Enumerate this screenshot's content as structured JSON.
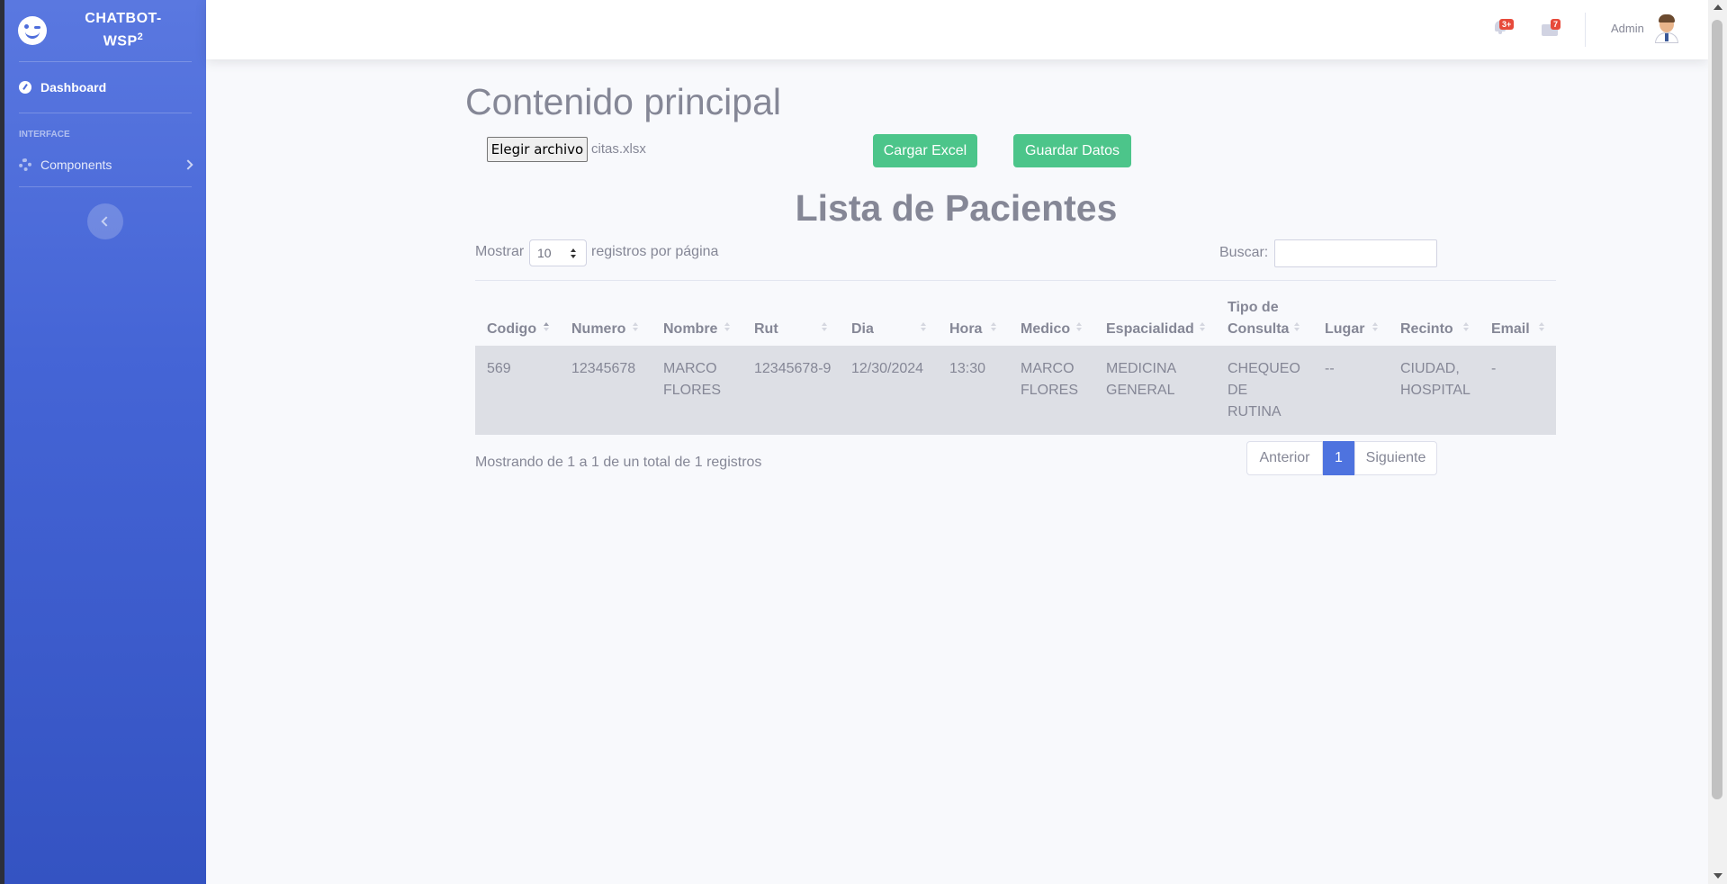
{
  "sidebar": {
    "brand_line1": "CHATBOT-",
    "brand_line2": "WSP",
    "brand_sup": "2",
    "nav_dashboard": "Dashboard",
    "heading_interface": "INTERFACE",
    "nav_components": "Components"
  },
  "topbar": {
    "alerts_badge": "3+",
    "messages_badge": "7",
    "user_name": "Admin"
  },
  "main": {
    "page_title": "Contenido principal",
    "file_button_label": "Elegir archivo",
    "file_name": "citas.xlsx",
    "load_button_label": "Cargar Excel",
    "save_button_label": "Guardar Datos",
    "list_title": "Lista de Pacientes",
    "show_label": "Mostrar",
    "page_size_value": "10",
    "show_suffix": "registros por página",
    "search_label": "Buscar:",
    "search_value": ""
  },
  "table": {
    "columns": [
      "Codigo",
      "Numero",
      "Nombre",
      "Rut",
      "Dia",
      "Hora",
      "Medico",
      "Espacialidad",
      "Tipo de Consulta",
      "Lugar",
      "Recinto",
      "Email"
    ],
    "rows": [
      {
        "codigo": "569",
        "numero": "12345678",
        "nombre": "MARCO FLORES",
        "rut": "12345678-9",
        "dia": "12/30/2024",
        "hora": "13:30",
        "medico": "MARCO FLORES",
        "especialidad": "MEDICINA GENERAL",
        "tipo_consulta": "CHEQUEO DE RUTINA",
        "lugar": "--",
        "recinto": "CIUDAD, HOSPITAL",
        "email": "-"
      }
    ]
  },
  "footer": {
    "info_text": "Mostrando de 1 a 1 de un total de 1 registros",
    "prev_label": "Anterior",
    "current_page": "1",
    "next_label": "Siguiente"
  },
  "colors": {
    "sidebar_gradient_top": "#5a78e0",
    "sidebar_gradient_bottom": "#3453c2",
    "button_green": "#4cc58a",
    "pagination_active": "#4e73df",
    "badge_red": "#e74a3b"
  }
}
